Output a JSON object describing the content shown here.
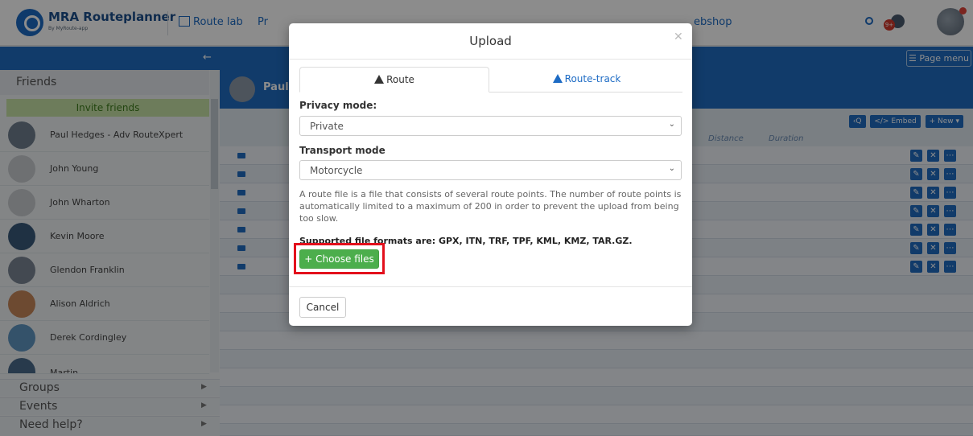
{
  "topnav": {
    "brand": "MRA Routeplanner",
    "brand_sub": "By MyRoute-app",
    "items": [
      {
        "label": "Route lab"
      },
      {
        "label": "Pr"
      },
      {
        "label": "ebshop"
      }
    ]
  },
  "notifications": {
    "badge": "9+"
  },
  "bluebar": {
    "page_menu": "☰ Page menu"
  },
  "sidebar": {
    "friends_title": "Friends",
    "invite_label": "Invite friends",
    "friends": [
      {
        "name": "Paul Hedges - Adv RouteXpert",
        "color": "#6f7e8e"
      },
      {
        "name": "John Young",
        "color": "#c9ccd0"
      },
      {
        "name": "John Wharton",
        "color": "#c9ccd0"
      },
      {
        "name": "Kevin Moore",
        "color": "#3a5a7a"
      },
      {
        "name": "Glendon Franklin",
        "color": "#7a8694"
      },
      {
        "name": "Alison Aldrich",
        "color": "#c7875a"
      },
      {
        "name": "Derek Cordingley",
        "color": "#5f95c2"
      },
      {
        "name": "Martin",
        "color": "#4a6a8a"
      }
    ],
    "sections": [
      "Groups",
      "Events",
      "Need help?"
    ]
  },
  "main": {
    "user_name": "Paul",
    "toolbar": {
      "embed": "</> Embed",
      "new": "+ New ▾"
    },
    "columns": {
      "distance": "Distance",
      "duration": "Duration"
    }
  },
  "modal": {
    "title": "Upload",
    "tabs": [
      {
        "label": "Route",
        "active": true
      },
      {
        "label": "Route-track",
        "active": false
      }
    ],
    "privacy_label": "Privacy mode:",
    "privacy_value": "Private",
    "transport_label": "Transport mode",
    "transport_value": "Motorcycle",
    "description": "A route file is a file that consists of several route points. The number of route points is automatically limited to a maximum of 200 in order to prevent the upload from being too slow.",
    "formats": "Supported file formats are: GPX, ITN, TRF, TPF, KML, KMZ, TAR.GZ.",
    "choose_files": "+ Choose files",
    "cancel": "Cancel"
  },
  "colors": {
    "accent": "#1f6cc2",
    "success": "#4cae4c",
    "highlight": "#e3101c"
  }
}
